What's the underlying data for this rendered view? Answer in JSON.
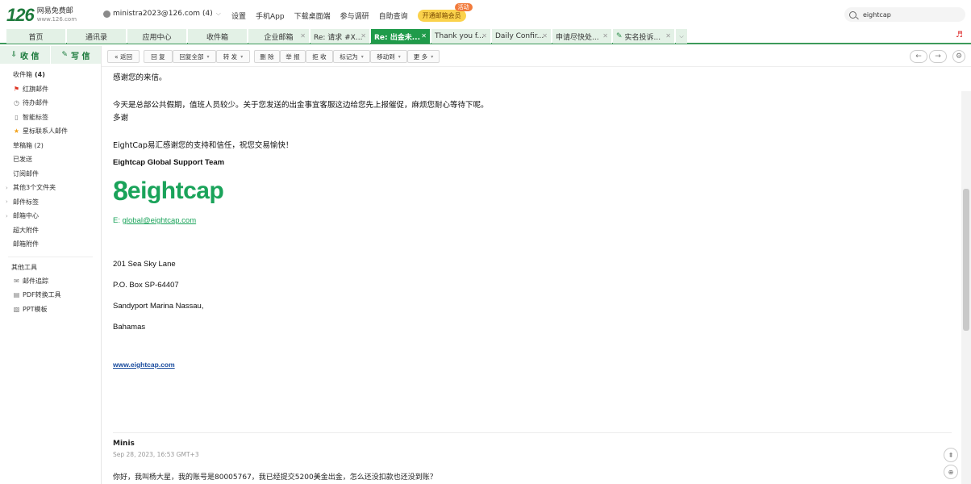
{
  "logo": {
    "number": "126",
    "name": "网易免费邮",
    "domain": "www.126.com"
  },
  "account": {
    "email": "ministra2023@126.com",
    "count": "(4)"
  },
  "topnav": {
    "settings": "设置",
    "app": "手机App",
    "desktop": "下载桌面端",
    "survey": "参与调研",
    "help": "自助查询",
    "vip": "开通邮箱会员",
    "vip_tag": "活动"
  },
  "search": {
    "value": "eightcap"
  },
  "tabs": [
    {
      "label": "首页"
    },
    {
      "label": "通讯录"
    },
    {
      "label": "应用中心"
    },
    {
      "label": "收件箱"
    },
    {
      "label": "企业邮箱"
    },
    {
      "label": "Re: 请求 #X..."
    },
    {
      "label": "Re: 出金未..."
    },
    {
      "label": "Thank you f..."
    },
    {
      "label": "Daily Confir..."
    },
    {
      "label": "申请尽快处..."
    },
    {
      "label": "实名投诉..."
    }
  ],
  "sidebar": {
    "receive": "收 信",
    "compose": "写 信",
    "inbox": "收件箱",
    "inbox_count": "(4)",
    "items": [
      {
        "label": "红旗邮件",
        "icon": "flag-icon"
      },
      {
        "label": "待办邮件",
        "icon": "clock-icon"
      },
      {
        "label": "智能标签",
        "icon": "tag-icon"
      },
      {
        "label": "星标联系人邮件",
        "icon": "star-icon"
      },
      {
        "label": "草稿箱 (2)"
      },
      {
        "label": "已发送"
      },
      {
        "label": "订阅邮件"
      },
      {
        "label": "其他3个文件夹"
      },
      {
        "label": "邮件标签"
      },
      {
        "label": "邮箱中心"
      },
      {
        "label": "超大附件"
      },
      {
        "label": "邮箱附件"
      }
    ],
    "tools_title": "其他工具",
    "tools": [
      {
        "label": "邮件追踪",
        "icon": "envelope-icon"
      },
      {
        "label": "PDF转换工具",
        "icon": "pdf-icon"
      },
      {
        "label": "PPT模板",
        "icon": "ppt-icon"
      }
    ]
  },
  "toolbar": {
    "back": "« 返回",
    "reply": "回 复",
    "reply_all": "回复全部",
    "forward": "转 发",
    "delete": "删 除",
    "report": "举 报",
    "reject": "拒 收",
    "mark": "标记为",
    "move": "移动到",
    "more": "更 多"
  },
  "mail": {
    "line1": "感谢您的来信。",
    "line2": "今天是总部公共假期，值班人员较少。关于您发送的出金事宜客服这边给您先上报催促，麻烦您耐心等待下呢。",
    "line3": "多谢",
    "line4": "EightCap易汇感谢您的支持和信任，祝您交易愉快！",
    "team": "Eightcap Global Support Team",
    "logo_eight": "8",
    "logo_word": "eightcap",
    "email_prefix": "E:",
    "email": "global@eightcap.com",
    "addr1": "201 Sea Sky Lane",
    "addr2": "P.O. Box SP-64407",
    "addr3": "Sandyport Marina Nassau,",
    "addr4": "Bahamas",
    "website": "www.eightcap.com"
  },
  "quoted": {
    "sender": "Minis",
    "date": "Sep 28, 2023, 16:53 GMT+3",
    "text": "你好，我叫杨大星，我的账号是80005767，我已经提交5200美金出金，怎么还没扣款也还没到账？"
  },
  "colors": {
    "brand_green": "#1f9b4a",
    "tab_light": "#e3f1e6",
    "logo_green": "#1aa35a",
    "link_blue": "#1a4c9e"
  }
}
